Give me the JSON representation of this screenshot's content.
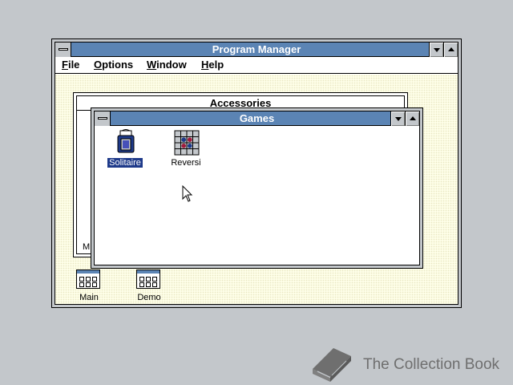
{
  "program_manager": {
    "title": "Program Manager",
    "menu": [
      {
        "underline": "F",
        "rest": "ile"
      },
      {
        "underline": "O",
        "rest": "ptions"
      },
      {
        "underline": "W",
        "rest": "indow"
      },
      {
        "underline": "H",
        "rest": "elp"
      }
    ]
  },
  "accessories": {
    "title": "Accessories",
    "partial_label": "M"
  },
  "games": {
    "title": "Games",
    "icons": [
      {
        "label": "Solitaire",
        "selected": true,
        "icon": "solitaire-icon"
      },
      {
        "label": "Reversi",
        "selected": false,
        "icon": "reversi-icon"
      }
    ]
  },
  "group_icons": [
    {
      "label": "Main",
      "icon": "program-group-icon"
    },
    {
      "label": "Demo",
      "icon": "program-group-icon"
    }
  ],
  "watermark": {
    "text": "The Collection Book",
    "icon": "book-icon"
  },
  "colors": {
    "title_active": "#5b84b4",
    "desktop": "#c3c7cb",
    "workspace": "#fefee8",
    "selection": "#1e3a8a"
  }
}
